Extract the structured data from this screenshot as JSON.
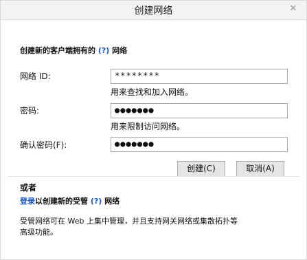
{
  "window": {
    "title": "创建网络"
  },
  "header": {
    "intro_prefix": "创建新的客户端拥有的",
    "help_link": "(?)",
    "intro_suffix": "网络"
  },
  "form": {
    "network_id": {
      "label": "网络 ID:",
      "value": "********",
      "helper": "用来查找和加入网络。"
    },
    "password": {
      "label": "密码:",
      "value": "●●●●●●●",
      "helper": "用来限制访问网络。"
    },
    "confirm_password": {
      "label": "确认密码(F):",
      "value": "●●●●●●●"
    }
  },
  "buttons": {
    "create": "创建(C)",
    "cancel": "取消(A)"
  },
  "alternate": {
    "or_label": "或者",
    "login_link": "登录",
    "middle_text": "以创建新的受管",
    "help_link": "(?)",
    "suffix": "网络"
  },
  "footnote": "受管网络可在 Web 上集中管理，并且支持网关网络或集散拓扑等高级功能。"
}
